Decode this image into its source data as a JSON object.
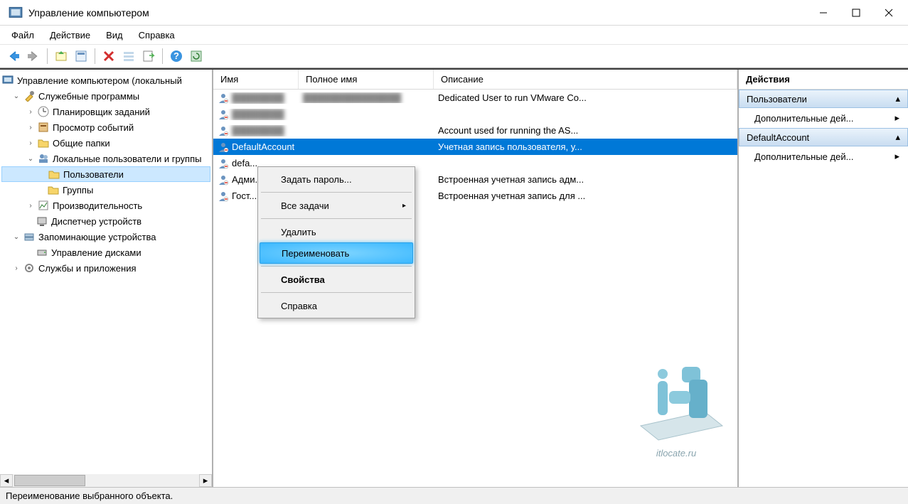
{
  "window": {
    "title": "Управление компьютером"
  },
  "menu": {
    "file": "Файл",
    "action": "Действие",
    "view": "Вид",
    "help": "Справка"
  },
  "tree": {
    "root": "Управление компьютером (локальный",
    "utilities": "Служебные программы",
    "scheduler": "Планировщик заданий",
    "events": "Просмотр событий",
    "shared": "Общие папки",
    "localusers": "Локальные пользователи и группы",
    "users": "Пользователи",
    "groups": "Группы",
    "performance": "Производительность",
    "devicemgr": "Диспетчер устройств",
    "storage": "Запоминающие устройства",
    "diskmgr": "Управление дисками",
    "services": "Службы и приложения"
  },
  "list": {
    "columns": {
      "name": "Имя",
      "fullname": "Полное имя",
      "description": "Описание"
    },
    "rows": [
      {
        "name": "████████",
        "fullname": "███████████████",
        "description": "Dedicated User to run VMware Co...",
        "blurred": true
      },
      {
        "name": "████████",
        "fullname": "",
        "description": "",
        "blurred": true
      },
      {
        "name": "████████",
        "fullname": "",
        "description": "Account used for running the AS...",
        "blurred": true
      },
      {
        "name": "DefaultAccount",
        "fullname": "",
        "description": "Учетная запись пользователя, у...",
        "selected": true
      },
      {
        "name": "defa...",
        "fullname": "",
        "description": ""
      },
      {
        "name": "Адми...",
        "fullname": "",
        "description": "Встроенная учетная запись адм..."
      },
      {
        "name": "Гост...",
        "fullname": "",
        "description": "Встроенная учетная запись для ..."
      }
    ]
  },
  "context": {
    "setpwd": "Задать пароль...",
    "alltasks": "Все задачи",
    "delete": "Удалить",
    "rename": "Переименовать",
    "properties": "Свойства",
    "help": "Справка"
  },
  "actions": {
    "title": "Действия",
    "group1": "Пользователи",
    "more1": "Дополнительные дей...",
    "group2": "DefaultAccount",
    "more2": "Дополнительные дей..."
  },
  "status": "Переименование выбранного объекта.",
  "watermark": "itlocate.ru"
}
